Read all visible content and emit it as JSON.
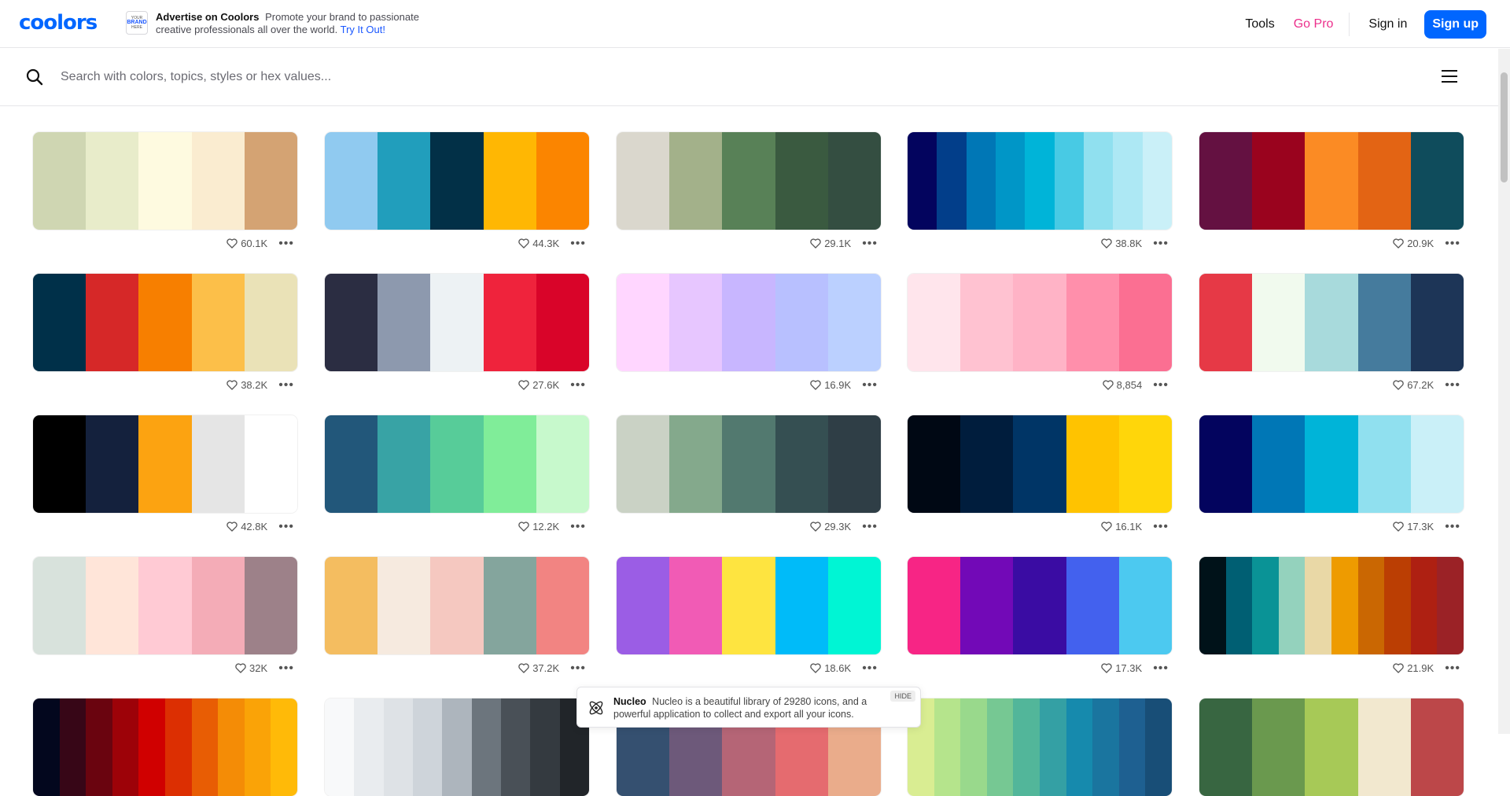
{
  "brand": {
    "logo_text": "coolors",
    "accent": "#0066ff"
  },
  "ad": {
    "badge_line1": "YOUR",
    "badge_line2": "BRAND",
    "badge_line3": "HERE",
    "title": "Advertise on Coolors",
    "text": "Promote your brand to passionate creative professionals all over the world.",
    "link": "Try It Out!"
  },
  "nav": {
    "tools": "Tools",
    "gopro": "Go Pro",
    "signin": "Sign in",
    "signup": "Sign up"
  },
  "search": {
    "placeholder": "Search with colors, topics, styles or hex values...",
    "value": ""
  },
  "palettes": [
    {
      "colors": [
        "#cfd6b2",
        "#e8ecca",
        "#fefae0",
        "#faecd0",
        "#d4a373"
      ],
      "likes": "60.1K"
    },
    {
      "colors": [
        "#90caf0",
        "#219ebc",
        "#023047",
        "#ffb703",
        "#fb8500"
      ],
      "likes": "44.3K"
    },
    {
      "colors": [
        "#dad7cd",
        "#a3b18a",
        "#588157",
        "#3a5a40",
        "#344e41"
      ],
      "likes": "29.1K"
    },
    {
      "colors": [
        "#03045e",
        "#023e8a",
        "#0077b6",
        "#0096c7",
        "#00b4d8",
        "#48cae4",
        "#90e0ef",
        "#ade8f4",
        "#caf0f8"
      ],
      "likes": "38.8K"
    },
    {
      "colors": [
        "#641141",
        "#9a031e",
        "#fb8b24",
        "#e36414",
        "#0f4c5c"
      ],
      "likes": "20.9K"
    },
    {
      "colors": [
        "#003049",
        "#d62828",
        "#f77f00",
        "#fcbf49",
        "#eae2b7"
      ],
      "likes": "38.2K"
    },
    {
      "colors": [
        "#2b2d42",
        "#8d99ae",
        "#edf2f4",
        "#ef233c",
        "#d90429"
      ],
      "likes": "27.6K"
    },
    {
      "colors": [
        "#ffd6ff",
        "#e7c6ff",
        "#c8b6ff",
        "#b8c0ff",
        "#bbd0ff"
      ],
      "likes": "16.9K"
    },
    {
      "colors": [
        "#ffe5ec",
        "#ffc2d1",
        "#ffb3c6",
        "#ff8fab",
        "#fb6f92"
      ],
      "likes": "8,854"
    },
    {
      "colors": [
        "#e63946",
        "#f1faee",
        "#a8dadc",
        "#457b9d",
        "#1d3557"
      ],
      "likes": "67.2K"
    },
    {
      "colors": [
        "#000000",
        "#14213d",
        "#fca311",
        "#e5e5e5",
        "#ffffff"
      ],
      "likes": "42.8K"
    },
    {
      "colors": [
        "#22577a",
        "#38a3a5",
        "#57cc99",
        "#80ed99",
        "#c7f9cc"
      ],
      "likes": "12.2K"
    },
    {
      "colors": [
        "#cad2c5",
        "#84a98c",
        "#52796f",
        "#354f52",
        "#2f3e46"
      ],
      "likes": "29.3K"
    },
    {
      "colors": [
        "#000814",
        "#001d3d",
        "#003566",
        "#ffc300",
        "#ffd60a"
      ],
      "likes": "16.1K"
    },
    {
      "colors": [
        "#03045e",
        "#0077b6",
        "#00b4d8",
        "#90e0ef",
        "#caf0f8"
      ],
      "likes": "17.3K"
    },
    {
      "colors": [
        "#d8e2dc",
        "#ffe5d9",
        "#ffcad4",
        "#f4acb7",
        "#9d8189"
      ],
      "likes": "32K"
    },
    {
      "colors": [
        "#f4bd60",
        "#f6eadf",
        "#f5c8c0",
        "#84a59d",
        "#f28482"
      ],
      "likes": "37.2K"
    },
    {
      "colors": [
        "#9b5de5",
        "#f15bb5",
        "#fee440",
        "#00bbf9",
        "#00f5d4"
      ],
      "likes": "18.6K"
    },
    {
      "colors": [
        "#f72585",
        "#7209b7",
        "#3a0ca3",
        "#4361ee",
        "#4cc9f0"
      ],
      "likes": "17.3K"
    },
    {
      "colors": [
        "#001219",
        "#005f73",
        "#0a9396",
        "#94d2bd",
        "#e9d8a6",
        "#ee9b00",
        "#ca6702",
        "#bb3e03",
        "#ae2012",
        "#9b2226"
      ],
      "likes": "21.9K"
    },
    {
      "colors": [
        "#03071e",
        "#370617",
        "#6a040f",
        "#9d0208",
        "#d00000",
        "#dc2f02",
        "#e85d04",
        "#f48c06",
        "#faa307",
        "#ffba08"
      ],
      "likes": ""
    },
    {
      "colors": [
        "#f8f9fa",
        "#e9ecef",
        "#dee2e6",
        "#ced4da",
        "#adb5bd",
        "#6c757d",
        "#495057",
        "#343a40",
        "#212529"
      ],
      "likes": ""
    },
    {
      "colors": [
        "#355070",
        "#6d597a",
        "#b56576",
        "#e56b6f",
        "#eaac8b"
      ],
      "likes": ""
    },
    {
      "colors": [
        "#d9ed92",
        "#b5e48c",
        "#99d98c",
        "#76c893",
        "#52b69a",
        "#34a0a4",
        "#168aad",
        "#1a759f",
        "#1e6091",
        "#184e77"
      ],
      "likes": ""
    },
    {
      "colors": [
        "#386641",
        "#6a994e",
        "#a7c957",
        "#f2e8cf",
        "#bc4749"
      ],
      "likes": ""
    }
  ],
  "popup": {
    "title": "Nucleo",
    "text": "Nucleo is a beautiful library of 29280 icons, and a powerful application to collect and export all your icons.",
    "hide": "HIDE"
  }
}
